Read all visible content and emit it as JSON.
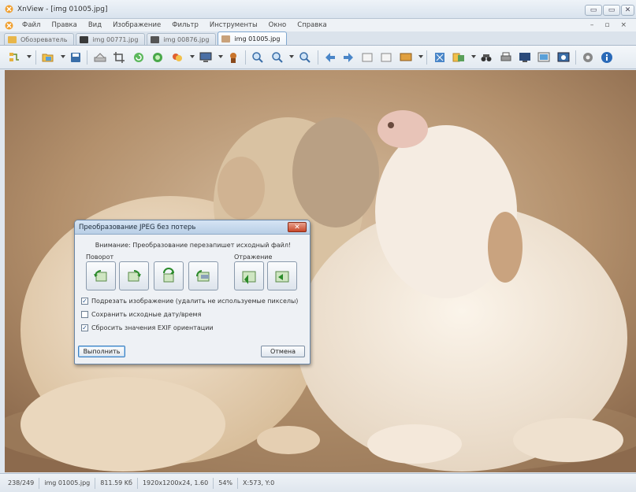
{
  "window": {
    "title": "XnView - [img 01005.jpg]",
    "buttons": {
      "minimize": "▭",
      "maximize": "▭",
      "close": "✕"
    }
  },
  "menu": {
    "items": [
      "Файл",
      "Правка",
      "Вид",
      "Изображение",
      "Фильтр",
      "Инструменты",
      "Окно",
      "Справка"
    ],
    "mdi_controls": {
      "minimize": "–",
      "restore": "▫",
      "close": "×"
    }
  },
  "tabs": [
    {
      "label": "Обозреватель",
      "active": false
    },
    {
      "label": "img 00771.jpg",
      "active": false
    },
    {
      "label": "img 00876.jpg",
      "active": false
    },
    {
      "label": "img 01005.jpg",
      "active": true
    }
  ],
  "toolbar": {
    "icons": [
      "browser-icon",
      "open-folder-icon",
      "save-icon",
      "scanner-icon",
      "crop-icon",
      "refresh-icon",
      "green-circle-icon",
      "paint-icon",
      "monitor-icon",
      "wizard-icon",
      "zoom-in-icon",
      "zoom-fit-icon",
      "zoom-out-icon",
      "back-arrow-icon",
      "forward-arrow-icon",
      "first-image-icon",
      "last-image-icon",
      "slideshow-icon",
      "fullscreen-icon",
      "compare-icon",
      "find-icon",
      "print-icon",
      "screen-icon",
      "thumbnail-icon",
      "capture-icon",
      "settings-icon",
      "info-icon"
    ]
  },
  "dialog": {
    "title": "Преобразование JPEG без потерь",
    "close_label": "✕",
    "warning": "Внимание: Преобразование перезапишет исходный файл!",
    "rotation_label": "Поворот",
    "mirror_label": "Отражение",
    "rotate_buttons": [
      "rotate-left-icon",
      "rotate-right-icon",
      "rotate-180-icon",
      "rotate-auto-icon"
    ],
    "mirror_buttons": [
      "flip-horizontal-icon",
      "flip-vertical-icon"
    ],
    "options": [
      {
        "label": "Подрезать изображение (удалить не используемые пикселы)",
        "checked": true
      },
      {
        "label": "Сохранить исходные дату/время",
        "checked": false
      },
      {
        "label": "Сбросить значения EXIF ориентации",
        "checked": true
      }
    ],
    "execute_label": "Выполнить",
    "cancel_label": "Отмена"
  },
  "status": {
    "index": "238/249",
    "filename": "img 01005.jpg",
    "filesize": "811.59 Kб",
    "dimensions": "1920x1200x24, 1.60",
    "zoom": "54%",
    "coords": "X:573, Y:0"
  },
  "colors": {
    "accent": "#3c7fbf",
    "title_gradient_top": "#d5e4f4",
    "photo_background": "#b99b78"
  }
}
